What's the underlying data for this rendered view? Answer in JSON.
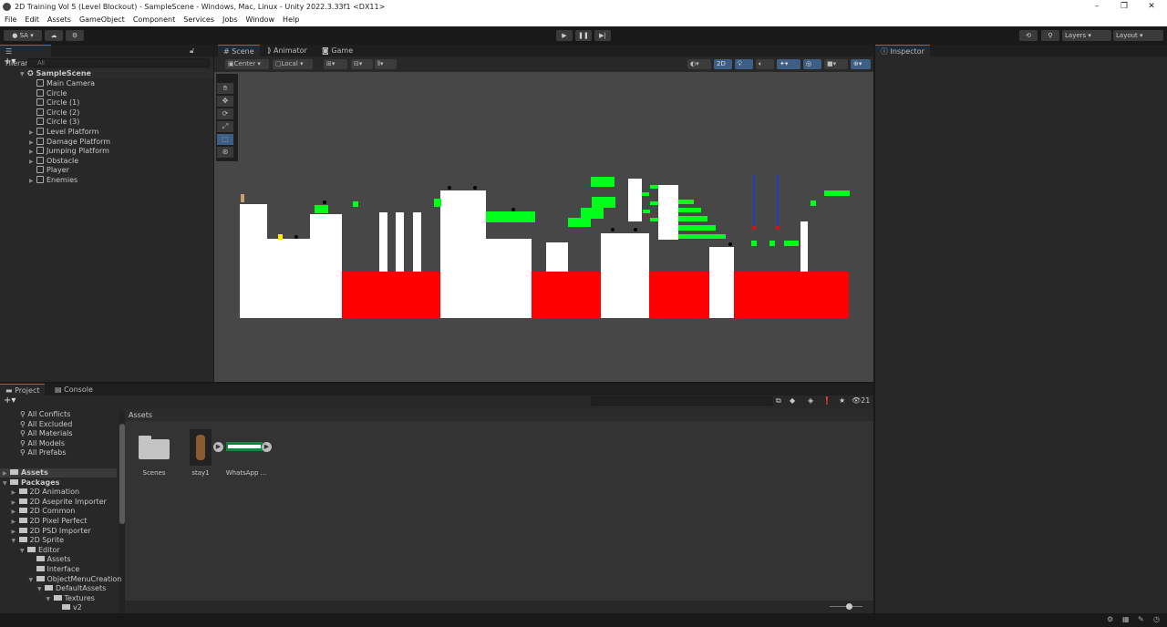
{
  "window": {
    "title": "2D Training Vol 5 (Level Blockout) - SampleScene - Windows, Mac, Linux - Unity 2022.3.33f1 <DX11>",
    "minimize": "–",
    "maximize": "❐",
    "close": "✕"
  },
  "menu": [
    "File",
    "Edit",
    "Assets",
    "GameObject",
    "Component",
    "Services",
    "Jobs",
    "Window",
    "Help"
  ],
  "toolbar": {
    "account": "SA ▾",
    "layers": "Layers",
    "layout": "Layout",
    "play": "▶",
    "pause": "❚❚",
    "step": "▶|"
  },
  "hierarchy": {
    "tab": "Hierarchy",
    "search_placeholder": "All",
    "scene": "SampleScene",
    "items": [
      {
        "label": "Main Camera",
        "expandable": false
      },
      {
        "label": "Circle",
        "expandable": false
      },
      {
        "label": "Circle (1)",
        "expandable": false
      },
      {
        "label": "Circle (2)",
        "expandable": false
      },
      {
        "label": "Circle (3)",
        "expandable": false
      },
      {
        "label": "Level Platform",
        "expandable": true
      },
      {
        "label": "Damage Platform",
        "expandable": true
      },
      {
        "label": "Jumping Platform",
        "expandable": true
      },
      {
        "label": "Obstacle",
        "expandable": true
      },
      {
        "label": "Player",
        "expandable": false
      },
      {
        "label": "Enemies",
        "expandable": true
      }
    ]
  },
  "scene_view": {
    "tabs": [
      "Scene",
      "Animator",
      "Game"
    ],
    "active_tab": "Scene",
    "pivot": "Center",
    "space": "Local",
    "mode_2d": "2D",
    "colors": {
      "platform": "#ffffff",
      "damage": "#ff0000",
      "jump": "#00ff1a",
      "background": "#474747"
    }
  },
  "inspector": {
    "tab": "Inspector"
  },
  "project": {
    "tabs": [
      "Project",
      "Console"
    ],
    "active_tab": "Project",
    "search_count": "21",
    "favorites": [
      "All Conflicts",
      "All Excluded",
      "All Materials",
      "All Models",
      "All Prefabs"
    ],
    "tree": [
      {
        "label": "Assets",
        "depth": 0,
        "bold": true
      },
      {
        "label": "Packages",
        "depth": 0,
        "bold": true
      },
      {
        "label": "2D Animation",
        "depth": 1
      },
      {
        "label": "2D Aseprite Importer",
        "depth": 1
      },
      {
        "label": "2D Common",
        "depth": 1
      },
      {
        "label": "2D Pixel Perfect",
        "depth": 1
      },
      {
        "label": "2D PSD Importer",
        "depth": 1
      },
      {
        "label": "2D Sprite",
        "depth": 1
      },
      {
        "label": "Editor",
        "depth": 2
      },
      {
        "label": "Assets",
        "depth": 3
      },
      {
        "label": "Interface",
        "depth": 3
      },
      {
        "label": "ObjectMenuCreation",
        "depth": 3
      },
      {
        "label": "DefaultAssets",
        "depth": 4
      },
      {
        "label": "Textures",
        "depth": 5
      },
      {
        "label": "v2",
        "depth": 6
      }
    ],
    "breadcrumb": "Assets",
    "assets": [
      {
        "label": "Scenes",
        "type": "folder"
      },
      {
        "label": "stay1",
        "type": "sprite"
      },
      {
        "label": "WhatsApp ...",
        "type": "image"
      }
    ]
  }
}
